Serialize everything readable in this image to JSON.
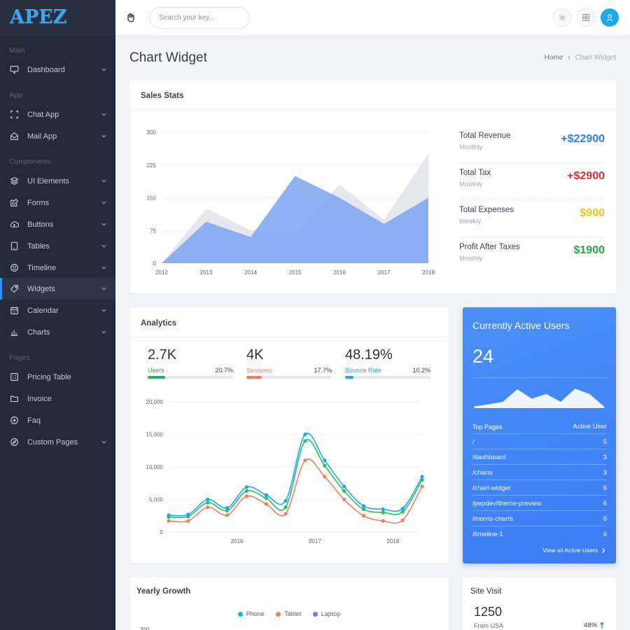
{
  "app": {
    "logo": "APEZ"
  },
  "colors": {
    "sidebar_bg": "#252a3a",
    "accent": "#3b8ff5",
    "revenue": "#2f7ff0",
    "tax": "#e0313b",
    "expenses": "#f4c11f",
    "profit": "#27a745"
  },
  "sidebar": {
    "sections": {
      "main": "Main",
      "app": "App",
      "components": "Components",
      "pages": "Pages"
    },
    "items": [
      {
        "label": "Dashboard",
        "icon": "monitor-icon"
      },
      {
        "label": "Chat App",
        "icon": "expand-icon"
      },
      {
        "label": "Mail App",
        "icon": "mail-open-icon"
      },
      {
        "label": "UI Elements",
        "icon": "layers-icon"
      },
      {
        "label": "Forms",
        "icon": "edit-icon"
      },
      {
        "label": "Buttons",
        "icon": "cloud-icon"
      },
      {
        "label": "Tables",
        "icon": "tablet-icon"
      },
      {
        "label": "Timeline",
        "icon": "smile-icon"
      },
      {
        "label": "Widgets",
        "icon": "tag-icon",
        "active": true
      },
      {
        "label": "Calendar",
        "icon": "calendar-icon"
      },
      {
        "label": "Charts",
        "icon": "bar-chart-icon"
      },
      {
        "label": "Pricing Table",
        "icon": "grid-icon"
      },
      {
        "label": "Invoice",
        "icon": "folder-icon"
      },
      {
        "label": "Faq",
        "icon": "plus-circle-icon"
      },
      {
        "label": "Custom Pages",
        "icon": "compass-icon"
      }
    ]
  },
  "topbar": {
    "search_placeholder": "Search your key..."
  },
  "header": {
    "title": "Chart Widget",
    "breadcrumb": [
      "Home",
      "Chart Widget"
    ]
  },
  "sales_stats": {
    "title": "Sales Stats",
    "stats": [
      {
        "label": "Total Revenue",
        "period": "Monthly",
        "value": "+$22900"
      },
      {
        "label": "Total Tax",
        "period": "Monthly",
        "value": "+$2900"
      },
      {
        "label": "Total Expenses",
        "period": "Weekly",
        "value": "$900"
      },
      {
        "label": "Profit After Taxes",
        "period": "Monthly",
        "value": "$1900"
      }
    ]
  },
  "analytics": {
    "title": "Analytics",
    "metrics": [
      {
        "value": "2.7K",
        "label": "Users",
        "percent": "20.7%",
        "fill": 0.207,
        "color": "#27ae60"
      },
      {
        "value": "4K",
        "label": "Sessions",
        "percent": "17.7%",
        "fill": 0.177,
        "color": "#f0805a"
      },
      {
        "value": "48.19%",
        "label": "Bounce Rate",
        "percent": "10.2%",
        "fill": 0.102,
        "color": "#1ea8ef"
      }
    ]
  },
  "active_users": {
    "title": "Currently Active Users",
    "count": "24",
    "col_left": "Top Pages",
    "col_right": "Active User",
    "rows": [
      {
        "page": "/",
        "users": "5"
      },
      {
        "page": "/dashboard",
        "users": "3"
      },
      {
        "page": "/charts",
        "users": "3"
      },
      {
        "page": "/chart-widget",
        "users": "6"
      },
      {
        "page": "/pepdev/theme-preview",
        "users": "6"
      },
      {
        "page": "/morris-charts",
        "users": "6"
      },
      {
        "page": "/timeline-1",
        "users": "6"
      }
    ],
    "view_all": "View all Active Users",
    "sparkline": [
      0.05,
      0.12,
      0.2,
      0.6,
      0.3,
      0.45,
      0.2,
      0.62,
      0.45,
      0.05
    ]
  },
  "yearly_growth": {
    "title": "Yearly Growth",
    "legend": [
      {
        "name": "Phone",
        "color": "#16b6c8"
      },
      {
        "name": "Tablet",
        "color": "#f0805a"
      },
      {
        "name": "Laptop",
        "color": "#8f6fe0"
      }
    ],
    "first_tick": "300"
  },
  "site_visit": {
    "title": "Site Visit",
    "value": "1250",
    "label": "From USA",
    "percent": "48%"
  },
  "chart_data": [
    {
      "type": "area",
      "title": "Sales Stats",
      "categories": [
        "2012",
        "2013",
        "2014",
        "2015",
        "2016",
        "2017",
        "2018"
      ],
      "ylim": [
        0,
        300
      ],
      "yticks": [
        0,
        75,
        150,
        225,
        300
      ],
      "series": [
        {
          "values": [
            0,
            125,
            75,
            70,
            180,
            100,
            250
          ],
          "color": "#e5e7ec"
        },
        {
          "values": [
            0,
            95,
            60,
            200,
            150,
            90,
            150
          ],
          "color": "#7ea7f2"
        }
      ]
    },
    {
      "type": "line",
      "title": "Analytics",
      "xticks": [
        "2016",
        "2017",
        "2018"
      ],
      "ylim": [
        0,
        20000
      ],
      "yticks": [
        "0",
        "5,000",
        "10,000",
        "15,000",
        "20,000"
      ],
      "x_count": 14,
      "xtick_positions": [
        3.5,
        7.5,
        11.5
      ],
      "series": [
        {
          "color": "#1ea8ef",
          "values": [
            2600,
            2700,
            5000,
            3700,
            6900,
            5700,
            4800,
            15000,
            11000,
            7000,
            4000,
            3500,
            3600,
            8500
          ]
        },
        {
          "color": "#27c06a",
          "values": [
            2300,
            2400,
            4500,
            3300,
            6300,
            5200,
            3800,
            14000,
            10200,
            6300,
            3500,
            3000,
            3100,
            8000
          ]
        },
        {
          "color": "#f0805a",
          "values": [
            1700,
            1700,
            3800,
            2600,
            5500,
            4300,
            2800,
            11000,
            8500,
            5000,
            2500,
            1700,
            1800,
            7000
          ]
        }
      ]
    }
  ]
}
